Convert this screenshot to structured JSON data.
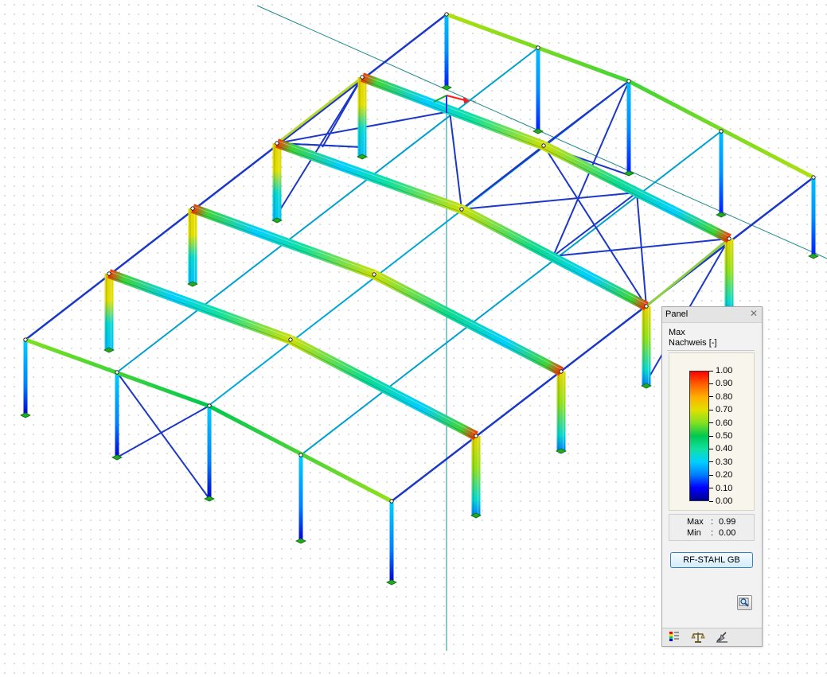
{
  "panel": {
    "title": "Panel",
    "close_icon": "close-icon",
    "result_type": "Max",
    "result_name": "Nachweis [-]",
    "legend_values": [
      "1.00",
      "0.90",
      "0.80",
      "0.70",
      "0.60",
      "0.50",
      "0.40",
      "0.30",
      "0.20",
      "0.10",
      "0.00"
    ],
    "max_label": "Max",
    "max_sep": ":",
    "max_value": "0.99",
    "min_label": "Min",
    "min_sep": ":",
    "min_value": "0.00",
    "module_button": "RF-STAHL GB",
    "zoom_icon": "magnifier-icon",
    "footer_tabs": [
      "color-scale-icon",
      "balance-scale-icon",
      "section-tool-icon"
    ]
  },
  "colors": {
    "accent_button_border": "#3c7fb1",
    "scale_max": "#ff0000",
    "scale_min": "#00008f"
  }
}
